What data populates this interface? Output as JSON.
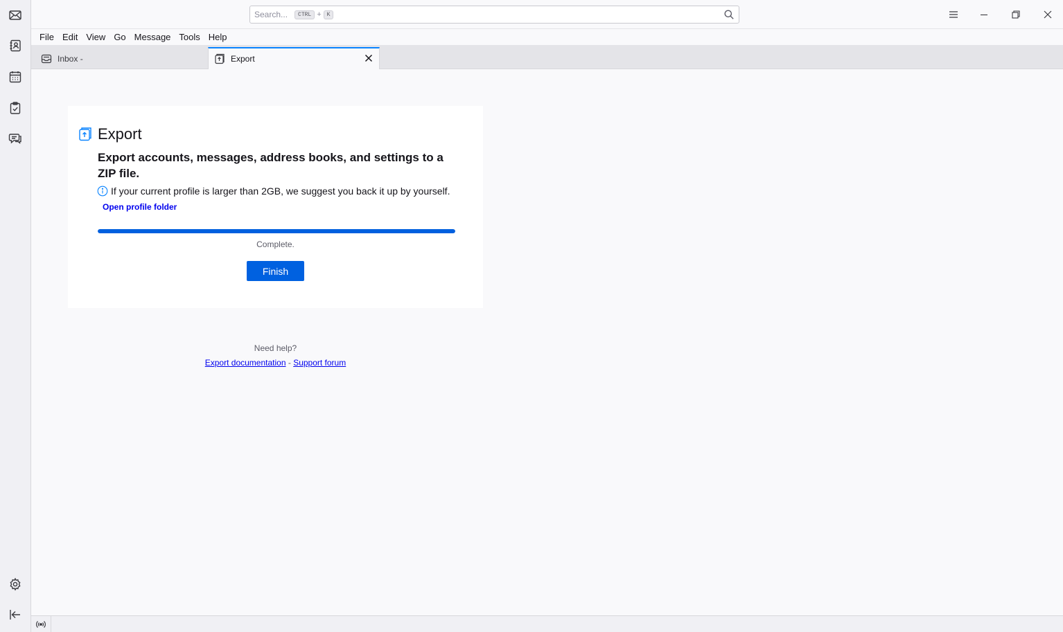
{
  "search": {
    "placeholder": "Search...",
    "shortcut_key1": "CTRL",
    "shortcut_plus": "+",
    "shortcut_key2": "K"
  },
  "menu": {
    "file": "File",
    "edit": "Edit",
    "view": "View",
    "go": "Go",
    "message": "Message",
    "tools": "Tools",
    "help": "Help"
  },
  "tabs": [
    {
      "label": "Inbox -",
      "icon": "inbox-icon"
    },
    {
      "label": "Export",
      "icon": "export-icon"
    }
  ],
  "export": {
    "title": "Export",
    "description": "Export accounts, messages, address books, and settings to a ZIP file.",
    "info": "If your current profile is larger than 2GB, we suggest you back it up by yourself.",
    "open_profile_link": "Open profile folder",
    "progress_fraction": 1.0,
    "status": "Complete.",
    "finish_label": "Finish"
  },
  "help": {
    "need_help": "Need help?",
    "doc_link": "Export documentation",
    "separator": "-",
    "forum_link": "Support forum"
  },
  "colors": {
    "accent": "#0061e0",
    "link": "#0000ee",
    "tab_active_border": "#0a84ff"
  }
}
